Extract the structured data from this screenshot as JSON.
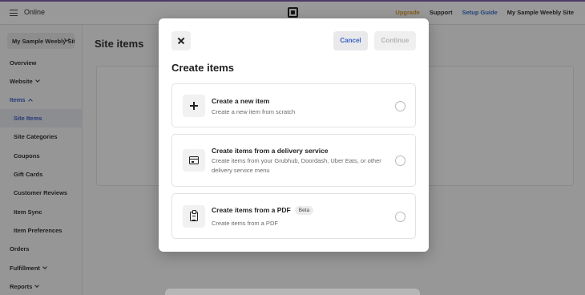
{
  "topbar": {
    "status": "Online",
    "nav": [
      "Upgrade",
      "Support",
      "Setup Guide",
      "My Sample Weebly Site"
    ],
    "accent_color": "#7a5fa8",
    "upgrade_color": "#d4952b",
    "link_color": "#3d6fc9"
  },
  "sidebar": {
    "site_select": "My Sample Weebly Site",
    "items": [
      {
        "label": "Overview"
      },
      {
        "label": "Website"
      },
      {
        "label": "Items"
      },
      {
        "label": "Site Items"
      },
      {
        "label": "Site Categories"
      },
      {
        "label": "Coupons"
      },
      {
        "label": "Gift Cards"
      },
      {
        "label": "Customer Reviews"
      },
      {
        "label": "Item Sync"
      },
      {
        "label": "Item Preferences"
      },
      {
        "label": "Orders"
      },
      {
        "label": "Fulfillment"
      },
      {
        "label": "Reports"
      }
    ]
  },
  "main": {
    "title": "Site items"
  },
  "modal": {
    "title": "Create items",
    "close_icon": "close-icon",
    "cancel_label": "Cancel",
    "continue_label": "Continue",
    "options": [
      {
        "title": "Create a new item",
        "description": "Create a new item from scratch",
        "icon": "plus-icon"
      },
      {
        "title": "Create items from a delivery service",
        "description": "Create items from your Grubhub, Doordash, Uber Eats, or other delivery service menu",
        "icon": "delivery-menu-icon"
      },
      {
        "title": "Create items from a PDF",
        "badge": "Beta",
        "description": "Create items from a PDF",
        "icon": "clipboard-icon"
      }
    ]
  }
}
